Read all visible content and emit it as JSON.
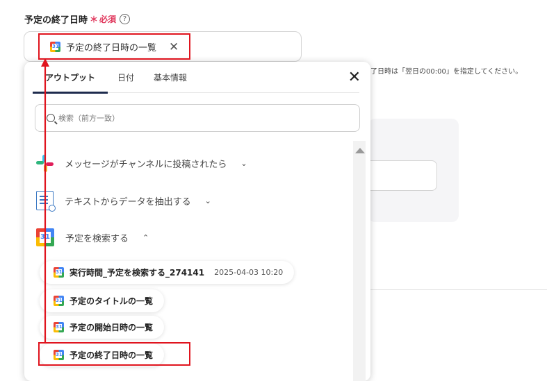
{
  "field": {
    "label": "予定の終了日時",
    "required_mark": "＊",
    "required_text": "必須",
    "help": "?"
  },
  "selected_chip": {
    "label": "予定の終了日時の一覧",
    "remove": "✕",
    "icon_text": "31"
  },
  "hint": "了日時は「翌日の00:00」を指定してください。",
  "panel": {
    "tabs": [
      "アウトプット",
      "日付",
      "基本情報"
    ],
    "close": "✕",
    "search_placeholder": "検索（前方一致）",
    "groups": [
      {
        "label": "メッセージがチャンネルに投稿されたら",
        "chevron": "⌄",
        "icon": "slack-icon"
      },
      {
        "label": "テキストからデータを抽出する",
        "chevron": "⌄",
        "icon": "document-search-icon"
      },
      {
        "label": "予定を検索する",
        "chevron": "⌃",
        "icon": "google-calendar-icon",
        "icon_text": "31"
      }
    ],
    "items": [
      {
        "label": "実行時間_予定を検索する_274141",
        "timestamp": "2025-04-03 10:20",
        "icon_text": "31"
      },
      {
        "label": "予定のタイトルの一覧",
        "icon_text": "31"
      },
      {
        "label": "予定の開始日時の一覧",
        "icon_text": "31"
      },
      {
        "label": "予定の終了日時の一覧",
        "icon_text": "31"
      }
    ]
  },
  "colors": {
    "required": "#e0365b",
    "highlight": "#e0141e",
    "tab_underline": "#1e2b4d"
  }
}
